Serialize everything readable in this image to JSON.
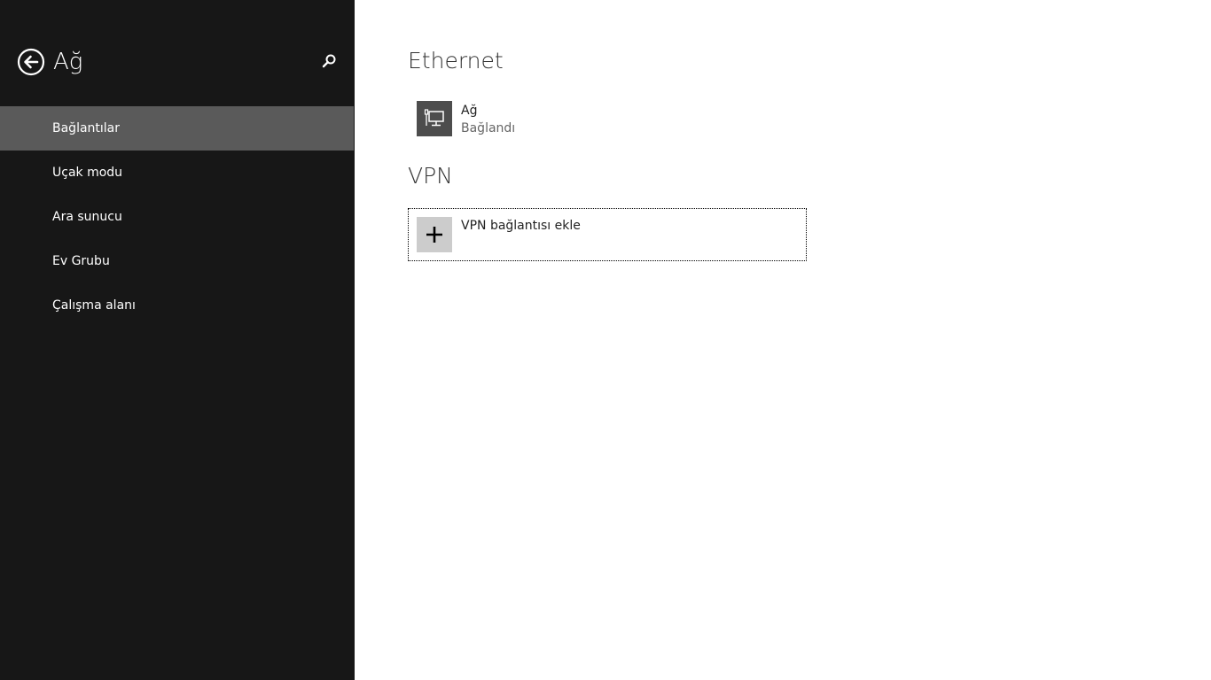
{
  "header": {
    "title": "Ağ"
  },
  "sidebar": {
    "items": [
      {
        "label": "Bağlantılar",
        "selected": true
      },
      {
        "label": "Uçak modu",
        "selected": false
      },
      {
        "label": "Ara sunucu",
        "selected": false
      },
      {
        "label": "Ev Grubu",
        "selected": false
      },
      {
        "label": "Çalışma alanı",
        "selected": false
      }
    ]
  },
  "main": {
    "ethernet": {
      "heading": "Ethernet",
      "network": {
        "name": "Ağ",
        "status": "Bağlandı",
        "icon": "wired-network-icon"
      }
    },
    "vpn": {
      "heading": "VPN",
      "add_label": "VPN bağlantısı ekle",
      "icon": "plus-icon"
    }
  },
  "colors": {
    "sidebar_bg": "#171717",
    "selected_bg": "#5a5a5a",
    "tile_dark": "#4d4d4d",
    "tile_light": "#cccccc"
  }
}
